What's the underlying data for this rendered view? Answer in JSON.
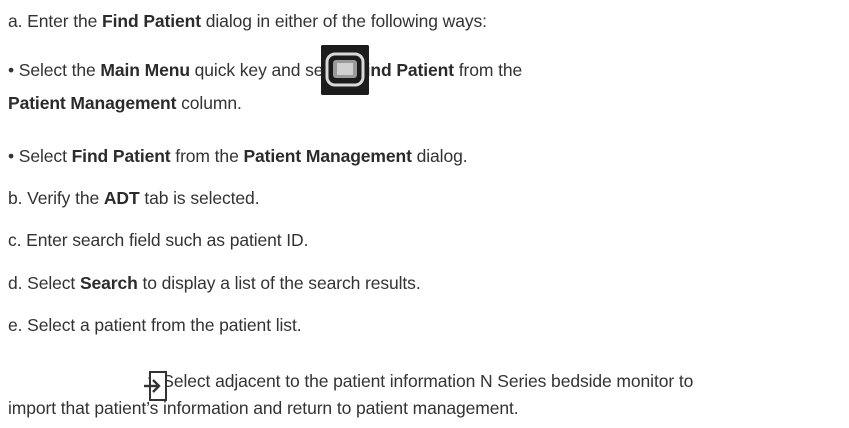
{
  "steps": {
    "a": {
      "prefix": "a. Enter the ",
      "bold": "Find Patient",
      "suffix": " dialog in either of the following ways:"
    },
    "bullet1": {
      "part1": " • Select the ",
      "bold1": "Main Menu",
      "part2": " quick key and select ",
      "bold2": "Find Patient",
      "part3": " from the",
      "bold3": "Patient Management",
      "part4": " column."
    },
    "bullet2": {
      "part1": " • Select ",
      "bold1": "Find Patient",
      "part2": " from the ",
      "bold2": "Patient Management",
      "part3": " dialog."
    },
    "b": {
      "prefix": "b. Verify the ",
      "bold": "ADT",
      "suffix": " tab is selected."
    },
    "c": {
      "text": "c. Enter search field such as patient ID."
    },
    "d": {
      "prefix": "d. Select ",
      "bold": "Search",
      "suffix": " to display a list of the search results."
    },
    "e": {
      "text": "e. Select a patient from the patient list."
    },
    "f": {
      "line1": "f. Select adjacent to the patient information N Series bedside monitor to",
      "line2": "import that patient’s information and return to patient management."
    }
  },
  "icons": {
    "main_menu": "main-menu-key-icon",
    "import": "import-patient-icon"
  }
}
